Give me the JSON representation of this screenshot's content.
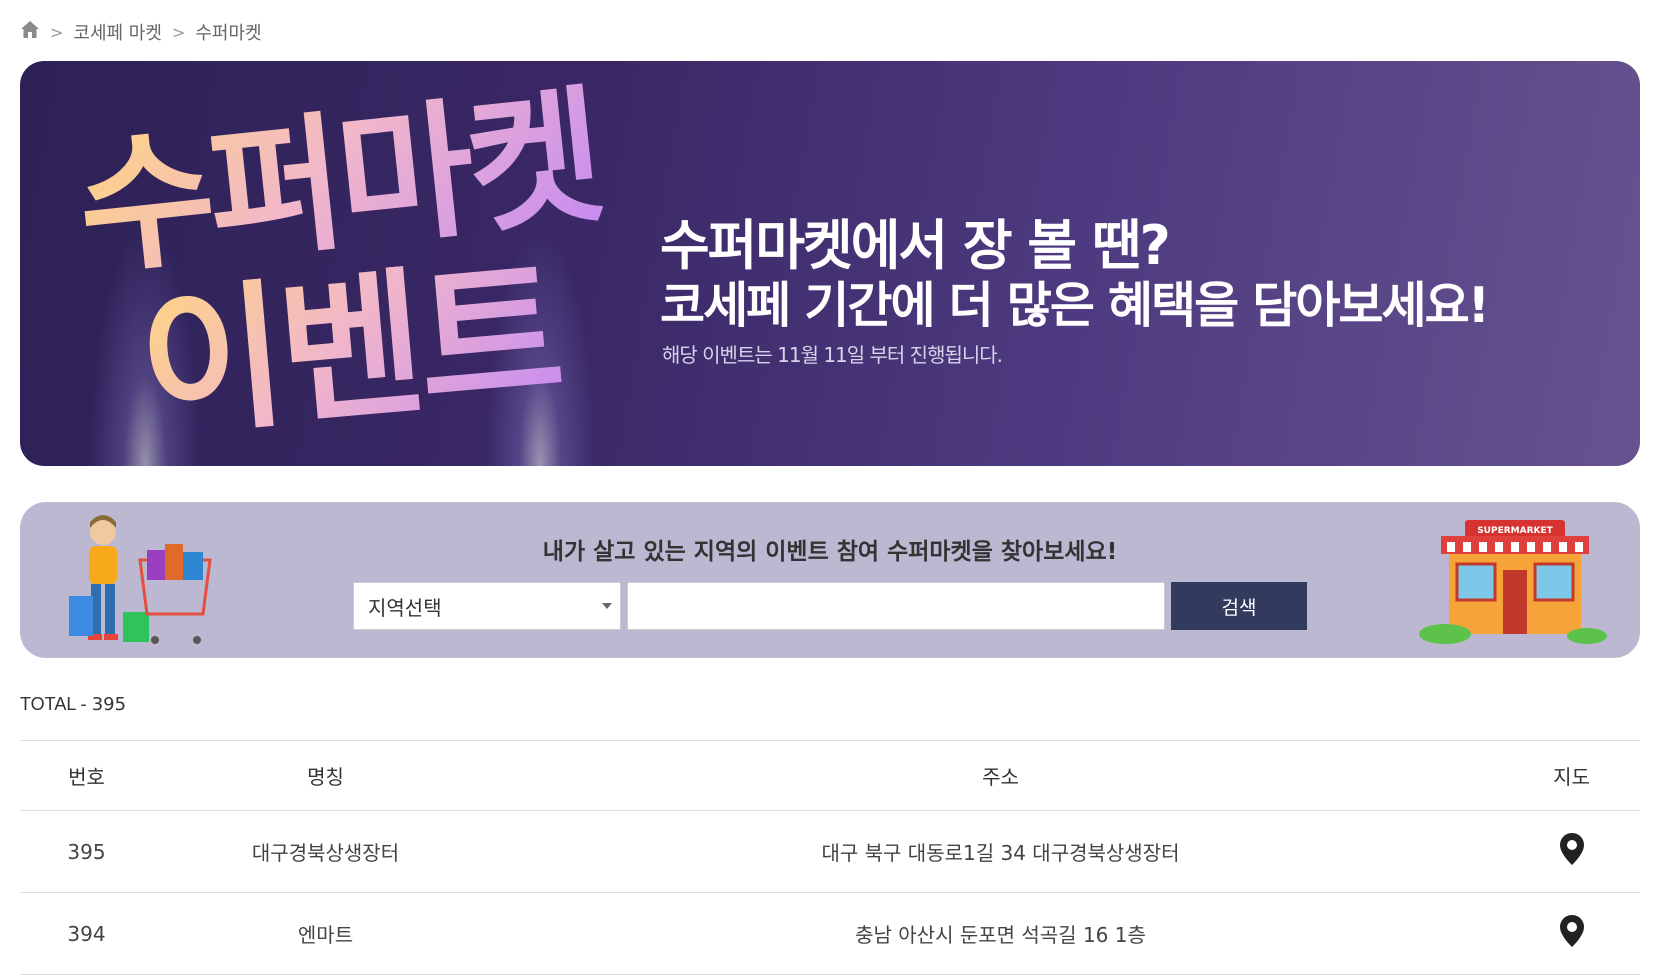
{
  "breadcrumb": {
    "home_icon": "home-icon",
    "items": [
      "코세페 마켓",
      "수퍼마켓"
    ]
  },
  "banner": {
    "title_line1": "수퍼마켓",
    "title_line2": "이벤트",
    "headline1": "수퍼마켓에서 장 볼 땐?",
    "headline2": "코세페 기간에 더 많은 혜택을 담아보세요!",
    "note": "해당 이벤트는 11월 11일 부터 진행됩니다."
  },
  "search": {
    "title": "내가 살고 있는 지역의 이벤트 참여 수퍼마켓을 찾아보세요!",
    "region_selected": "지역선택",
    "keyword_value": "",
    "button_label": "검색",
    "store_sign": "SUPERMARKET"
  },
  "summary": {
    "total_label": "TOTAL - ",
    "total_value": "395"
  },
  "table": {
    "headers": {
      "no": "번호",
      "name": "명칭",
      "address": "주소",
      "map": "지도"
    },
    "rows": [
      {
        "no": "395",
        "name": "대구경북상생장터",
        "address": "대구 북구 대동로1길 34 대구경북상생장터",
        "map_icon": "map-pin-icon"
      },
      {
        "no": "394",
        "name": "엔마트",
        "address": "충남 아산시 둔포면 석곡길 16 1층",
        "map_icon": "map-pin-icon"
      }
    ]
  },
  "colors": {
    "search_button": "#323a5e",
    "search_panel": "#bcb8d1",
    "banner_bg": "#3a2866"
  }
}
